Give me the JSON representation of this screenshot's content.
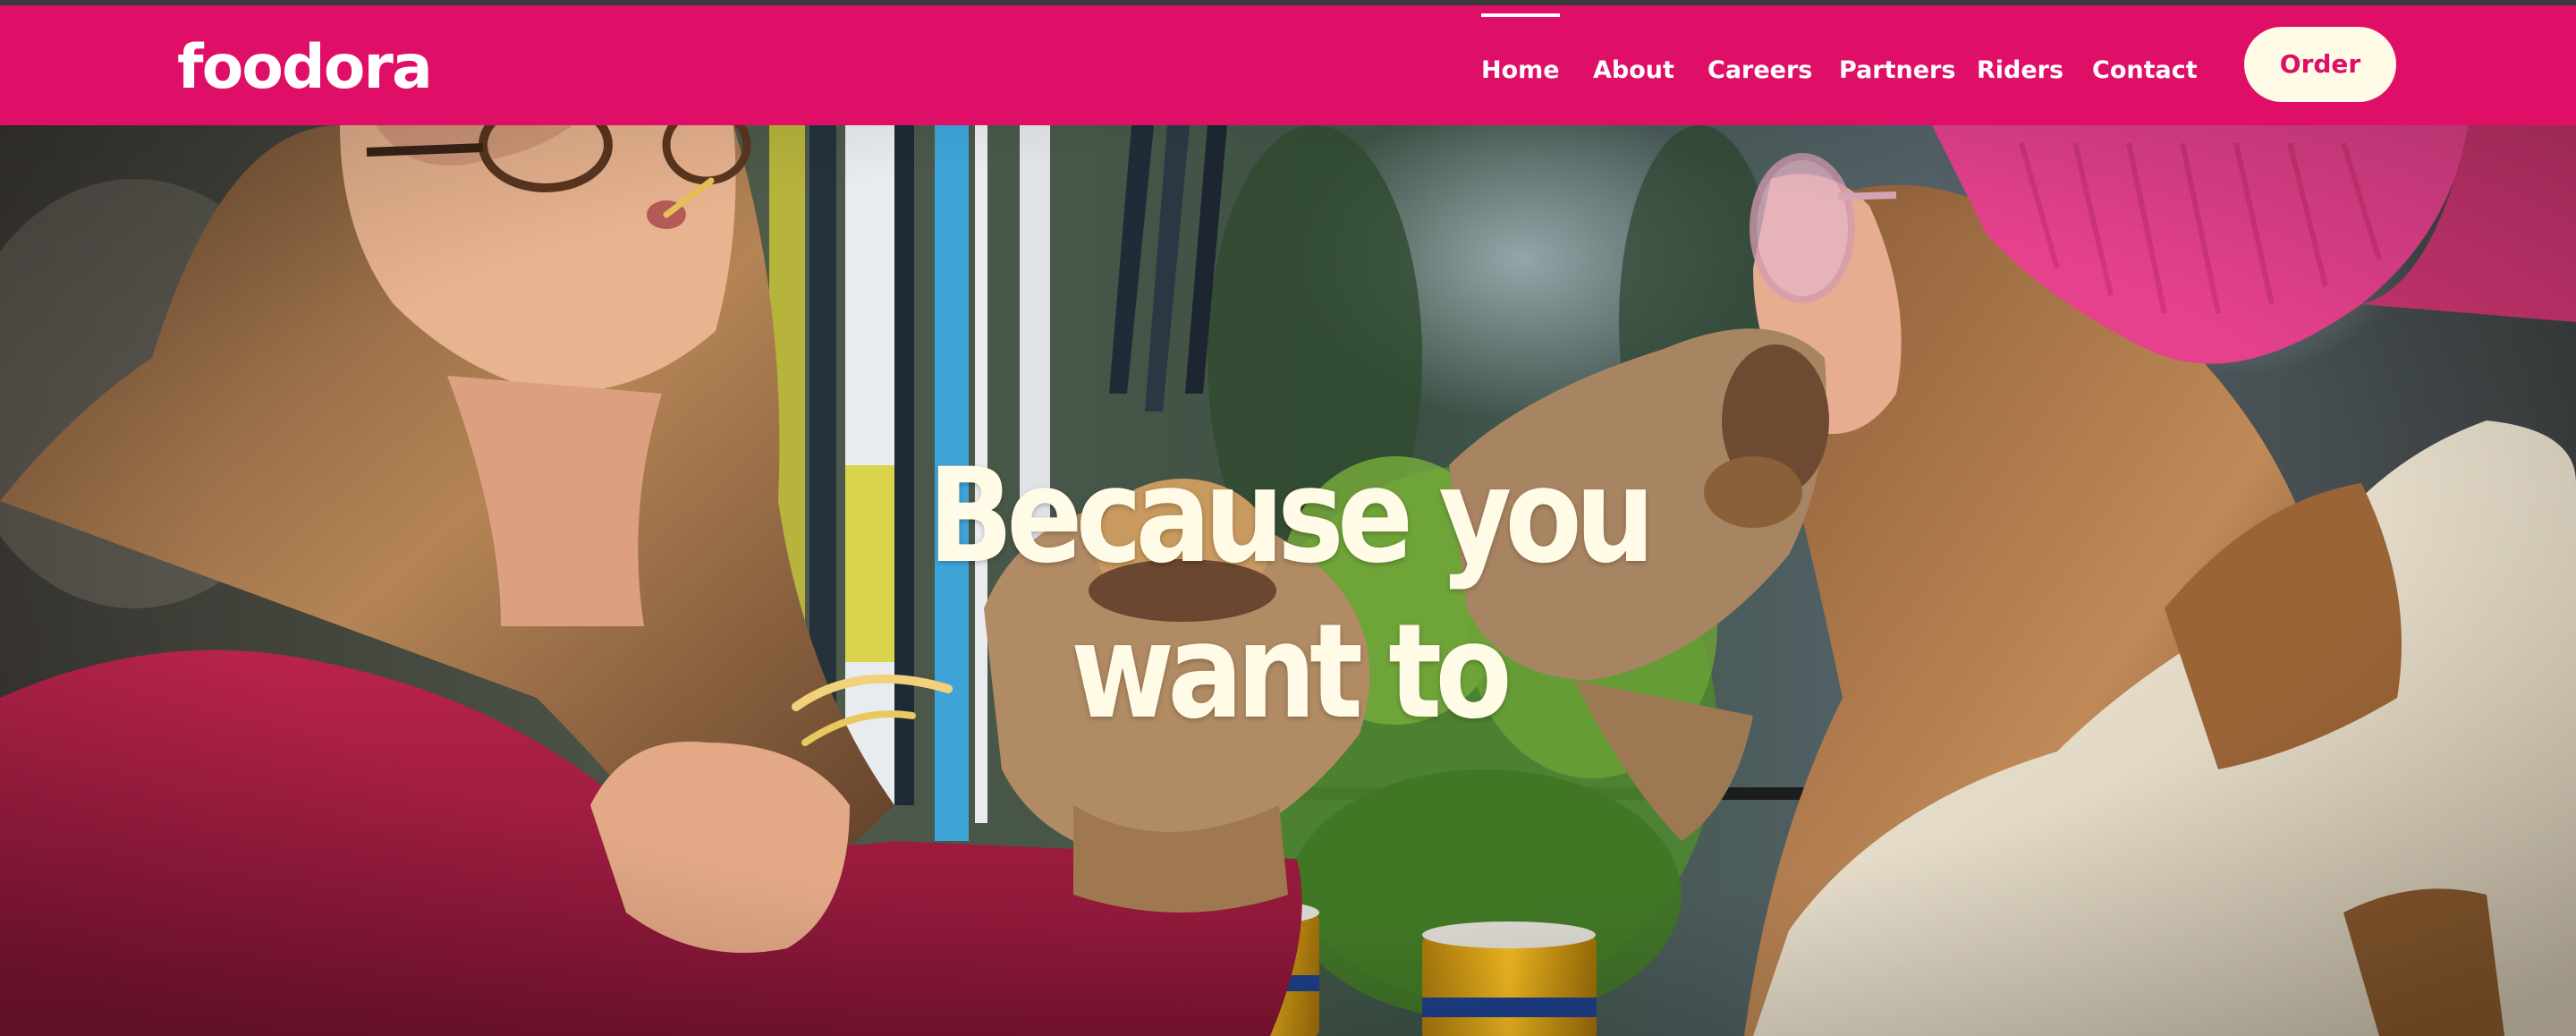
{
  "header": {
    "logo_text": "foodora",
    "nav": [
      {
        "label": "Home",
        "active": true
      },
      {
        "label": "About",
        "active": false
      },
      {
        "label": "Careers",
        "active": false
      },
      {
        "label": "Partners",
        "active": false
      },
      {
        "label": "Riders",
        "active": false
      },
      {
        "label": "Contact",
        "active": false
      }
    ],
    "order_label": "Order"
  },
  "hero": {
    "headline_line1": "Because you",
    "headline_line2": "want to"
  },
  "colors": {
    "brand_pink": "#df0e66",
    "cream": "#fffbe6",
    "top_strip": "#3b3b3b"
  }
}
